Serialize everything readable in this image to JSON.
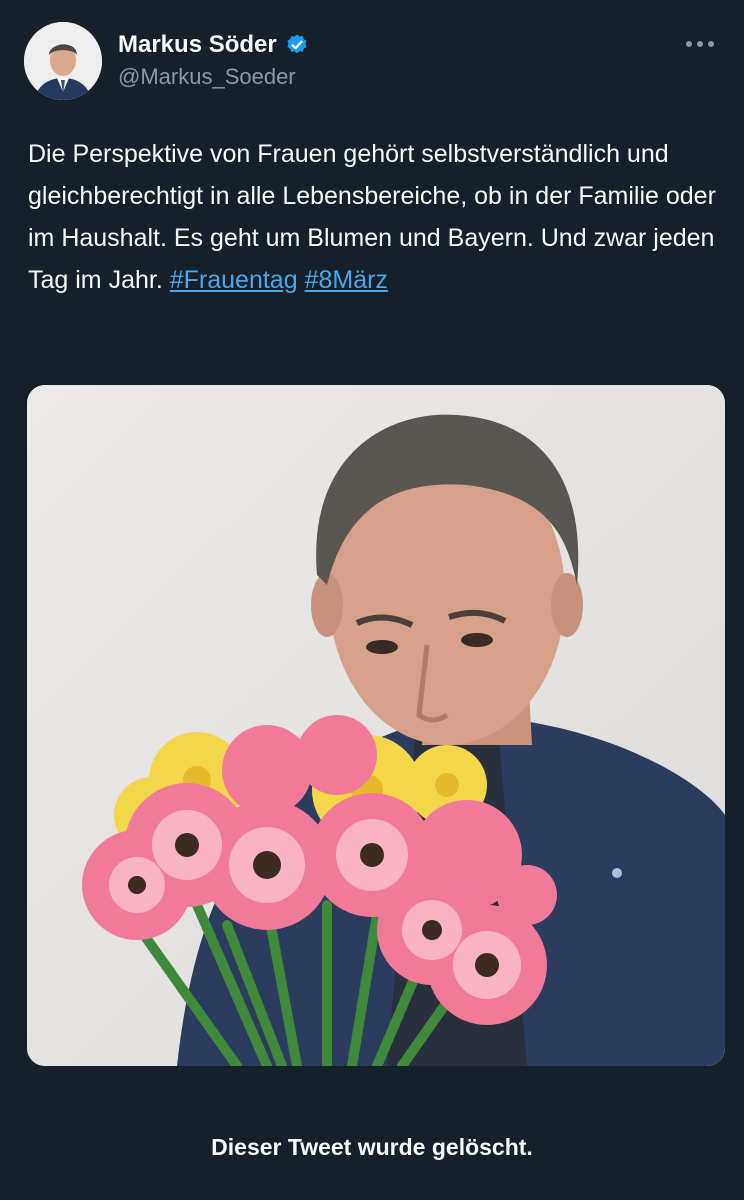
{
  "author": {
    "display_name": "Markus Söder",
    "handle": "@Markus_Soeder",
    "verified_icon": "verified-badge-icon",
    "avatar_icon": "avatar-photo"
  },
  "tweet": {
    "text_part": "Die Perspektive von Frauen gehört selbstverständlich und gleichberechtigt in alle Lebensbereiche, ob in der Familie oder im Haushalt. Es geht um Blumen und Bayern. Und zwar jeden Tag im Jahr.",
    "hashtags": [
      "#Frauentag",
      "#8März"
    ]
  },
  "more_icon": "more-options-icon",
  "status": {
    "deleted_label": "Dieser Tweet wurde gelöscht."
  },
  "colors": {
    "background": "#15202b",
    "link": "#4aa7e8",
    "verified": "#1d9bf0"
  }
}
